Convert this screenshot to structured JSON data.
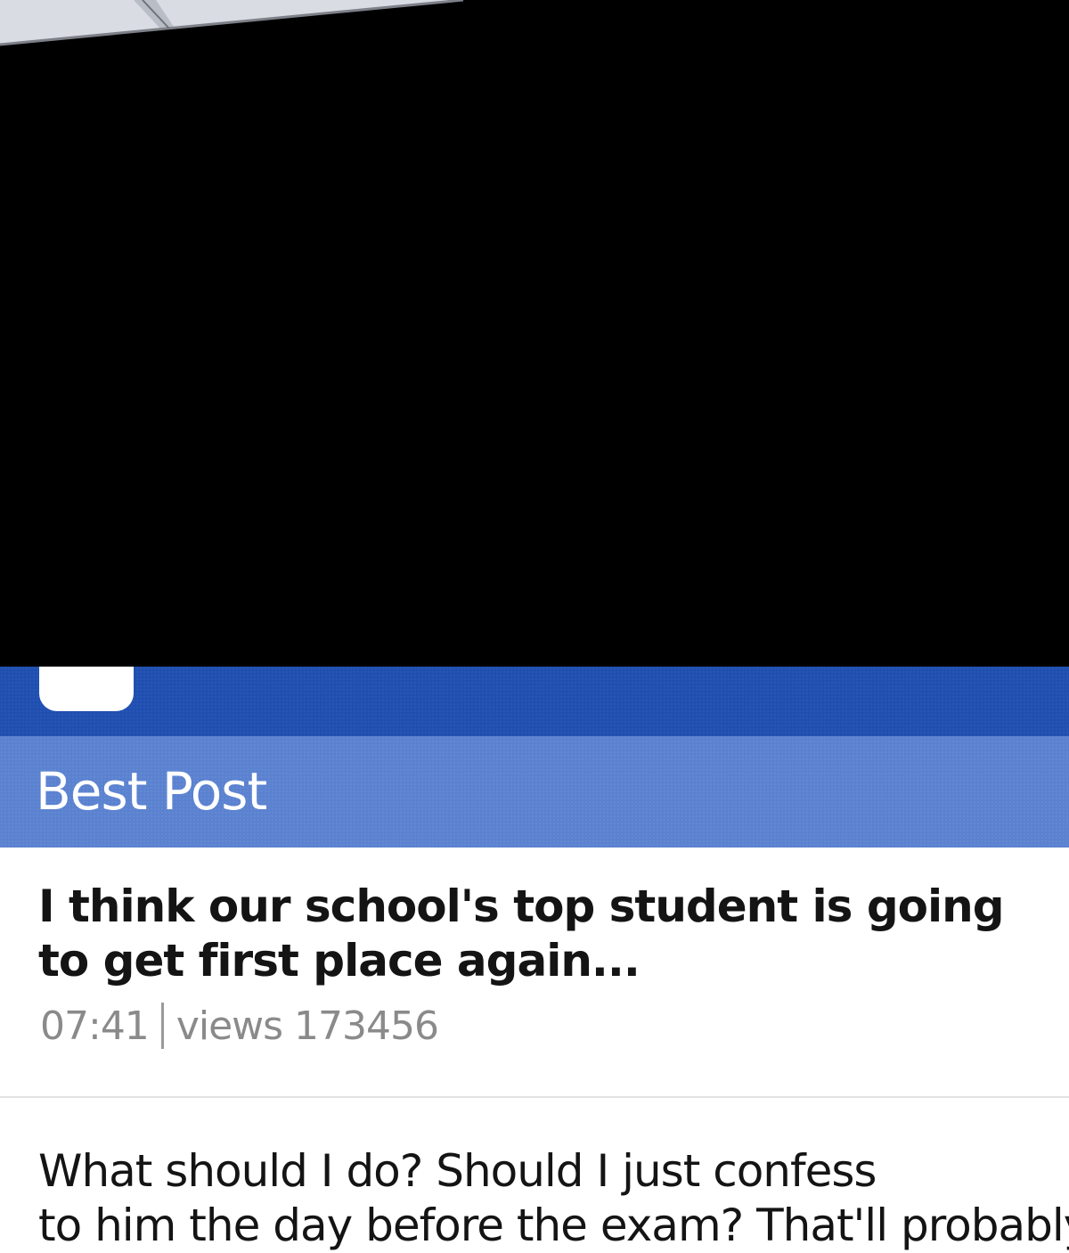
{
  "section": {
    "title": "Best Post"
  },
  "posts": [
    {
      "title_lines": [
        "I think our school's top student is going",
        "to get first place again..."
      ],
      "time": "07:41",
      "views": "views 173456"
    },
    {
      "body_lines": [
        "What should I do? Should I just confess",
        "to him the day before the exam? That'll probably"
      ]
    }
  ],
  "colors": {
    "header_band": "#1f4fb0",
    "section_header": "#5b82d0",
    "text": "#141414",
    "meta": "#8a8a8a"
  }
}
